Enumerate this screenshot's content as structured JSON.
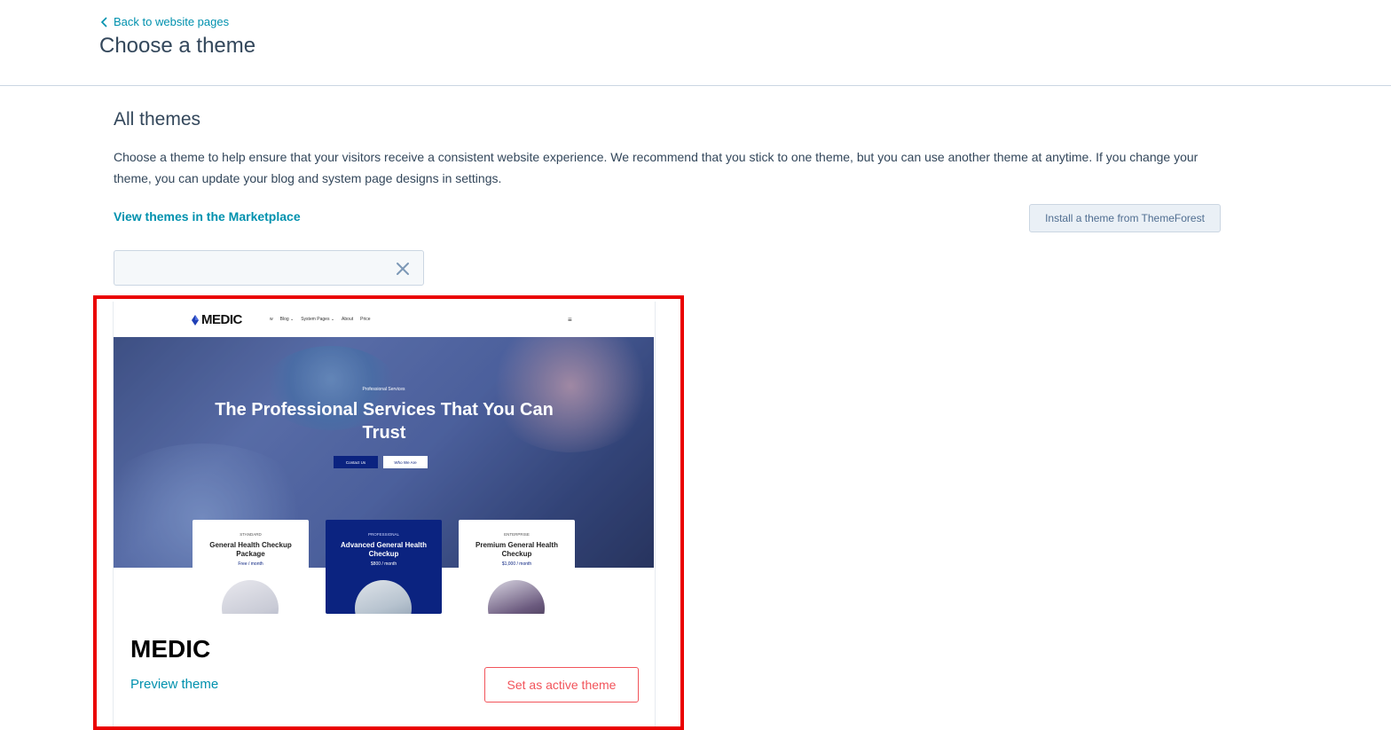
{
  "header": {
    "back_label": "Back to website pages",
    "title": "Choose a theme"
  },
  "section": {
    "title": "All themes",
    "description": "Choose a theme to help ensure that your visitors receive a consistent website experience. We recommend that you stick to one theme, but you can use another theme at anytime. If you change your theme, you can update your blog and system page designs in settings.",
    "marketplace_link": "View themes in the Marketplace",
    "install_button": "Install a theme from ThemeForest"
  },
  "search": {
    "value": "",
    "placeholder": ""
  },
  "theme_card": {
    "name": "MEDIC",
    "preview_link": "Preview theme",
    "set_active_button": "Set as active theme",
    "thumbnail": {
      "logo": "MEDIC",
      "menu": [
        "w",
        "Blog ⌄",
        "System Pages ⌄",
        "About",
        "Price"
      ],
      "menu_icon": "≡",
      "hero_tag": "Professional Services",
      "hero_title": "The Professional Services That You Can Trust",
      "hero_btn_primary": "Contact Us",
      "hero_btn_secondary": "Who We Are",
      "plans": [
        {
          "tier": "Standard",
          "title": "General Health Checkup Package",
          "price": "Free / month"
        },
        {
          "tier": "Professional",
          "title": "Advanced General Health Checkup",
          "price": "$800 / month"
        },
        {
          "tier": "Enterprise",
          "title": "Premium General Health Checkup",
          "price": "$1,000 / month"
        }
      ]
    }
  },
  "colors": {
    "link": "#0091ae",
    "accent": "#f2545b",
    "highlight": "#ea0000",
    "text": "#33475b",
    "theme_navy": "#0b2380"
  }
}
